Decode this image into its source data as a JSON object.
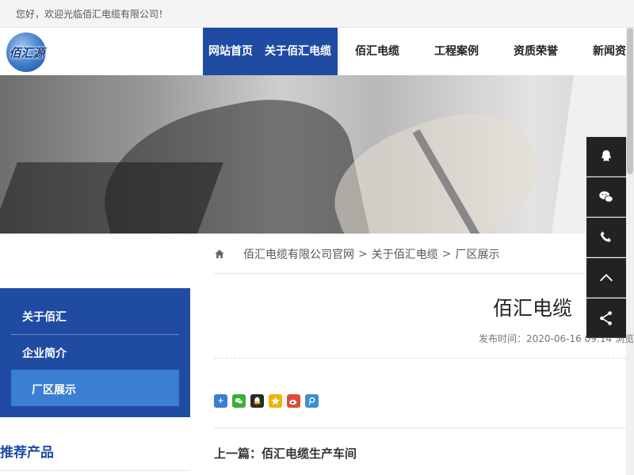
{
  "topbar": {
    "welcome": "您好，欢迎光临佰汇电缆有限公司！"
  },
  "logo": {
    "text": "佰汇源"
  },
  "nav": {
    "items": [
      {
        "label": "网站首页",
        "active": true
      },
      {
        "label": "关于佰汇电缆",
        "active": true
      },
      {
        "label": "佰汇电缆",
        "active": false
      },
      {
        "label": "工程案例",
        "active": false
      },
      {
        "label": "资质荣誉",
        "active": false
      },
      {
        "label": "新闻资",
        "active": false
      }
    ]
  },
  "breadcrumb": {
    "items": [
      "佰汇电缆有限公司官网",
      "关于佰汇电缆",
      "厂区展示"
    ],
    "separator": ">"
  },
  "sidebar": {
    "heading": "关于佰汇",
    "items": [
      {
        "label": "企业简介"
      },
      {
        "label": "厂区展示",
        "active": true
      }
    ]
  },
  "recommend": {
    "title": "推荐产品"
  },
  "article": {
    "title": "佰汇电缆",
    "meta": "发布时间：2020-06-16 09:14  浏览"
  },
  "share": {
    "icons": [
      "share-more-icon",
      "wechat-icon",
      "qq-icon",
      "qzone-icon",
      "weibo-icon",
      "tencent-weibo-icon"
    ],
    "colors": [
      "#3b7ed4",
      "#3cae3a",
      "#2a2a2a",
      "#f0b400",
      "#e04a3a",
      "#3a8fd0"
    ]
  },
  "pagination": {
    "prev": "上一篇：佰汇电缆生产车间"
  },
  "floatbar": {
    "icons": [
      "qq-icon",
      "wechat-icon",
      "phone-icon",
      "chevron-up-icon",
      "share-icon"
    ]
  },
  "colors": {
    "brand": "#1f4ba3",
    "accent": "#3a7fd1",
    "float": "#222222"
  }
}
